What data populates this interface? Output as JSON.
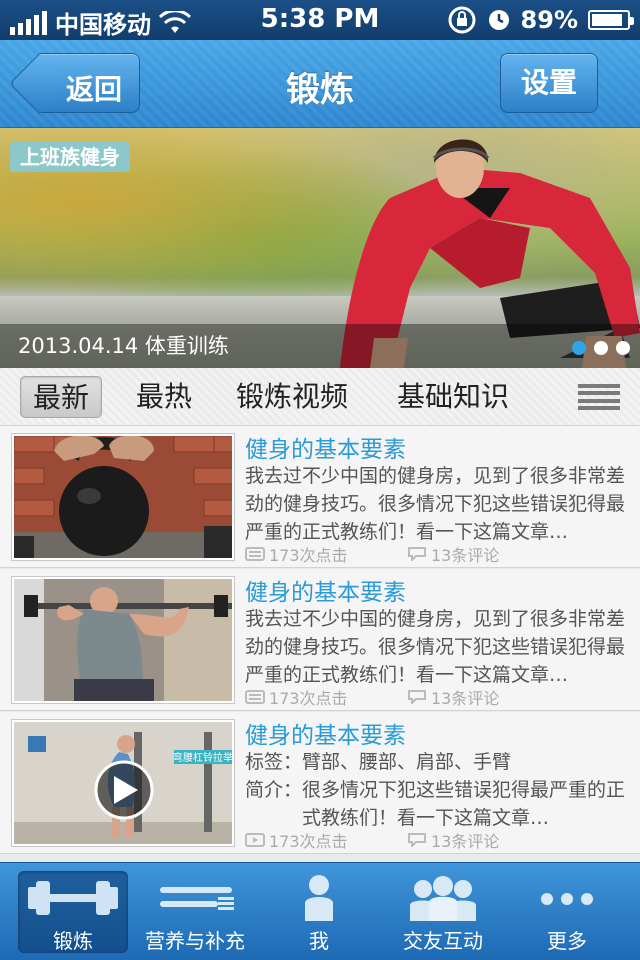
{
  "status_bar": {
    "carrier": "中国移动",
    "time": "5:38 PM",
    "battery": "89%",
    "battery_level": 0.89
  },
  "nav": {
    "back_label": "返回",
    "title": "锻炼",
    "settings_label": "设置"
  },
  "hero": {
    "tag": "上班族健身",
    "caption": "2013.04.14 体重训练",
    "slides": 3,
    "active_slide": 1
  },
  "tabs": [
    {
      "label": "最新",
      "active": true
    },
    {
      "label": "最热",
      "active": false
    },
    {
      "label": "锻炼视频",
      "active": false
    },
    {
      "label": "基础知识",
      "active": false
    }
  ],
  "articles": [
    {
      "title": "健身的基本要素",
      "summary": "我去过不少中国的健身房，见到了很多非常差劲的健身技巧。很多情况下犯这些错误犯得最严重的正式教练们！看一下这篇文章…",
      "clicks": "173次点击",
      "comments": "13条评论",
      "thumbnail_icon": "kettlebell-photo"
    },
    {
      "title": "健身的基本要素",
      "summary": "我去过不少中国的健身房，见到了很多非常差劲的健身技巧。很多情况下犯这些错误犯得最严重的正式教练们！看一下这篇文章…",
      "clicks": "173次点击",
      "comments": "13条评论",
      "thumbnail_icon": "squat-photo"
    },
    {
      "title": "健身的基本要素",
      "tags_label": "标签：",
      "tags": "臂部、腰部、肩部、手臂",
      "intro_label": "简介：",
      "intro": "很多情况下犯这些错误犯得最严重的正式教练们！看一下这篇文章…",
      "clicks": "173次点击",
      "comments": "13条评论",
      "thumbnail_icon": "video-play-photo",
      "video_badge": "弯腰杠铃拉举"
    }
  ],
  "tab_bar": [
    {
      "label": "锻炼",
      "icon": "dumbbell-icon",
      "active": true
    },
    {
      "label": "营养与补充",
      "icon": "knife-fork-icon",
      "active": false
    },
    {
      "label": "我",
      "icon": "person-icon",
      "active": false
    },
    {
      "label": "交友互动",
      "icon": "group-icon",
      "active": false
    },
    {
      "label": "更多",
      "icon": "more-dots-icon",
      "active": false
    }
  ],
  "colors": {
    "accent": "#2a9ad8",
    "nav_blue": "#2d86cf",
    "tab_bar_blue": "#1e6ab4",
    "dot_active": "#2fa4e7"
  }
}
